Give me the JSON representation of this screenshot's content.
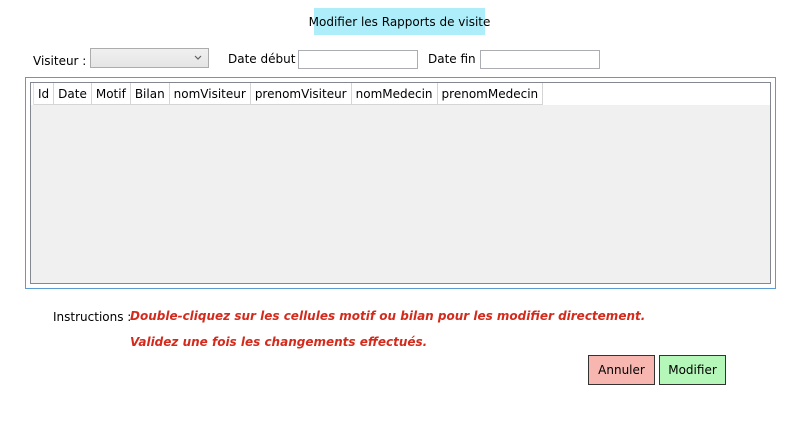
{
  "window": {
    "title": "Modifier les Rapports de visite"
  },
  "filters": {
    "visiteur_label": "Visiteur :",
    "visiteur_value": "",
    "date_debut_label": "Date début :",
    "date_debut_value": "",
    "date_fin_label": "Date fin :",
    "date_fin_value": ""
  },
  "grid": {
    "columns": [
      "Id",
      "Date",
      "Motif",
      "Bilan",
      "nomVisiteur",
      "prenomVisiteur",
      "nomMedecin",
      "prenomMedecin"
    ],
    "rows": []
  },
  "instructions": {
    "label": "Instructions :",
    "line1": "Double-cliquez sur les cellules motif ou bilan pour les modifier directement.",
    "line2": "Validez une fois les changements effectués."
  },
  "buttons": {
    "annuler": "Annuler",
    "modifier": "Modifier"
  },
  "colors": {
    "title_bg": "#aeeefa",
    "instructions_text": "#d42a1c",
    "annuler_bg": "#f7b6b0",
    "modifier_bg": "#b4f7b8",
    "grid_focus_border": "#5b9bd5"
  }
}
